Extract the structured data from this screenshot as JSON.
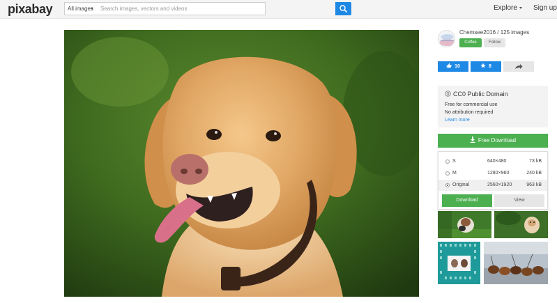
{
  "header": {
    "logo": "pixabay",
    "search_category": "All images",
    "search_placeholder": "Search images, vectors and videos",
    "explore_label": "Explore",
    "signup_label": "Sign up"
  },
  "photo": {
    "subject": "golden retriever dog"
  },
  "author": {
    "line": "Chemsee2016 / 125 images",
    "coffee_label": "Coffee",
    "follow_label": "Follow"
  },
  "actions": {
    "likes": "10",
    "favorites": "8"
  },
  "license": {
    "title": "CC0 Public Domain",
    "line1": "Free for commercial use",
    "line2": "No attribution required",
    "link": "Learn more"
  },
  "download": {
    "button_label": "Free Download",
    "options": [
      {
        "size": "S",
        "dims": "640×480",
        "kb": "73 kB"
      },
      {
        "size": "M",
        "dims": "1280×960",
        "kb": "240 kB"
      },
      {
        "size": "Original",
        "dims": "2560×1920",
        "kb": "963 kB"
      }
    ],
    "selected": "Original",
    "panel_download_label": "Download",
    "panel_view_label": "View"
  },
  "colors": {
    "accent_blue": "#1e88e5",
    "accent_green": "#4caf50"
  },
  "icons": [
    "search-icon",
    "thumbs-up-icon",
    "star-icon",
    "share-arrow-icon",
    "download-icon",
    "cc0-icon"
  ]
}
